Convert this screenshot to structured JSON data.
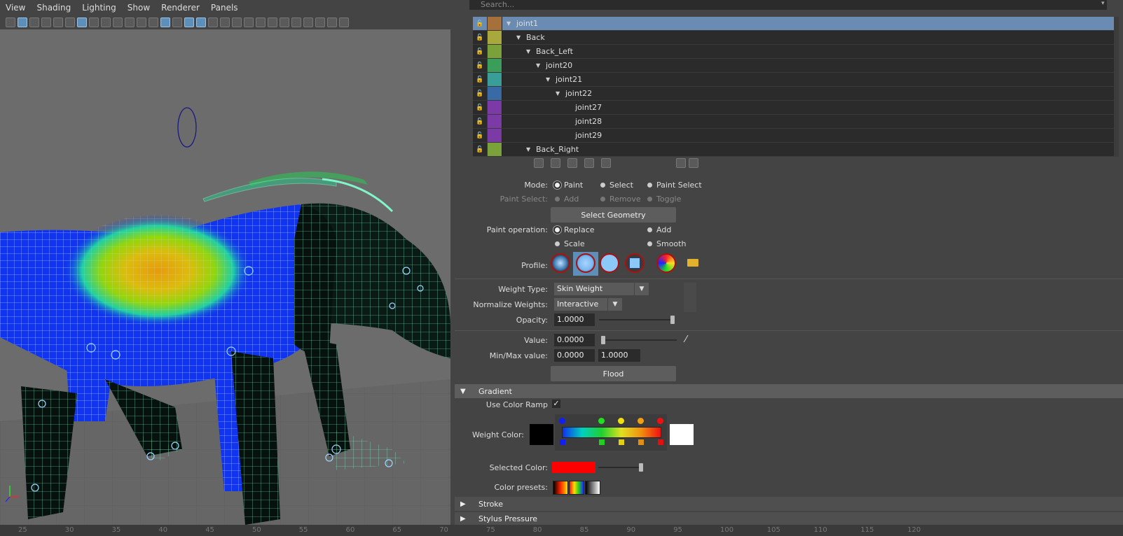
{
  "menu": [
    "View",
    "Shading",
    "Lighting",
    "Show",
    "Renderer",
    "Panels"
  ],
  "search": {
    "placeholder": "Search..."
  },
  "tree": [
    {
      "label": "joint1",
      "color": "#a5703a",
      "depth": 0,
      "expanded": true,
      "selected": true
    },
    {
      "label": "Back",
      "color": "#a8a83c",
      "depth": 1,
      "expanded": true
    },
    {
      "label": "Back_Left",
      "color": "#7aa13a",
      "depth": 2,
      "expanded": true
    },
    {
      "label": "joint20",
      "color": "#3a9d5a",
      "depth": 3,
      "expanded": true
    },
    {
      "label": "joint21",
      "color": "#3a9e98",
      "depth": 4,
      "expanded": true
    },
    {
      "label": "joint22",
      "color": "#3a6aa6",
      "depth": 5,
      "expanded": true
    },
    {
      "label": "joint27",
      "color": "#7c3aa6",
      "depth": 6,
      "expanded": false
    },
    {
      "label": "joint28",
      "color": "#7c3aa6",
      "depth": 6,
      "expanded": false
    },
    {
      "label": "joint29",
      "color": "#7c3aa6",
      "depth": 6,
      "expanded": false
    },
    {
      "label": "Back_Right",
      "color": "#7aa13a",
      "depth": 2,
      "expanded": true
    }
  ],
  "mode": {
    "label": "Mode:",
    "options": [
      "Paint",
      "Select",
      "Paint Select"
    ],
    "selected": "Paint"
  },
  "paint_select": {
    "label": "Paint Select:",
    "options": [
      "Add",
      "Remove",
      "Toggle"
    ]
  },
  "select_geometry_label": "Select Geometry",
  "paint_operation": {
    "label": "Paint operation:",
    "options": [
      "Replace",
      "Add",
      "Scale",
      "Smooth"
    ],
    "selected": "Replace"
  },
  "profile_label": "Profile:",
  "weight_type": {
    "label": "Weight Type:",
    "value": "Skin Weight"
  },
  "normalize": {
    "label": "Normalize Weights:",
    "value": "Interactive"
  },
  "opacity": {
    "label": "Opacity:",
    "value": "1.0000",
    "level": 1.0
  },
  "value": {
    "label": "Value:",
    "value": "0.0000",
    "level": 0.0
  },
  "minmax": {
    "label": "Min/Max value:",
    "min": "0.0000",
    "max": "1.0000"
  },
  "flood_label": "Flood",
  "gradient": {
    "title": "Gradient",
    "use_color_ramp_label": "Use Color Ramp",
    "use_color_ramp": true,
    "weight_color_label": "Weight Color:",
    "selected_color_label": "Selected Color:",
    "selected_color": "#ff0000",
    "color_presets_label": "Color presets:"
  },
  "stroke_title": "Stroke",
  "stylus_title": "Stylus Pressure",
  "ruler_ticks": [
    "25",
    "30",
    "35",
    "40",
    "45",
    "50",
    "55",
    "60",
    "65",
    "70",
    "75",
    "80",
    "85",
    "90",
    "95",
    "100",
    "105",
    "110",
    "115",
    "120"
  ]
}
